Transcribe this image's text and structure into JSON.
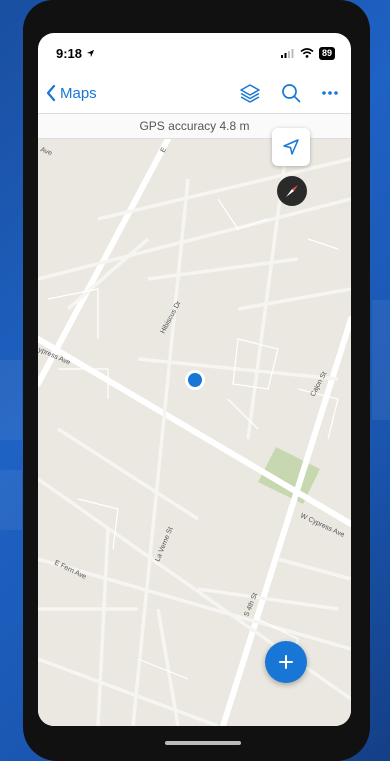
{
  "status_bar": {
    "time": "9:18",
    "battery": "89"
  },
  "navbar": {
    "back_label": "Maps"
  },
  "gps": {
    "accuracy_text": "GPS accuracy 4.8 m"
  },
  "map": {
    "streets": {
      "cypress_ave": "ypress Ave",
      "hibiscus_dr": "Hibiscus Dr",
      "cajon_st": "Cajon St",
      "w_cypress_ave": "W Cypress Ave",
      "la_verne_st": "La Verne St",
      "e_fern_ave": "E Fern Ave",
      "s_4th_st": "S 4th St",
      "ave_top": "Ave",
      "e_top": "E"
    }
  },
  "colors": {
    "accent": "#1877d6",
    "location_dot": "#1877d6",
    "park": "#c7d8b0"
  }
}
